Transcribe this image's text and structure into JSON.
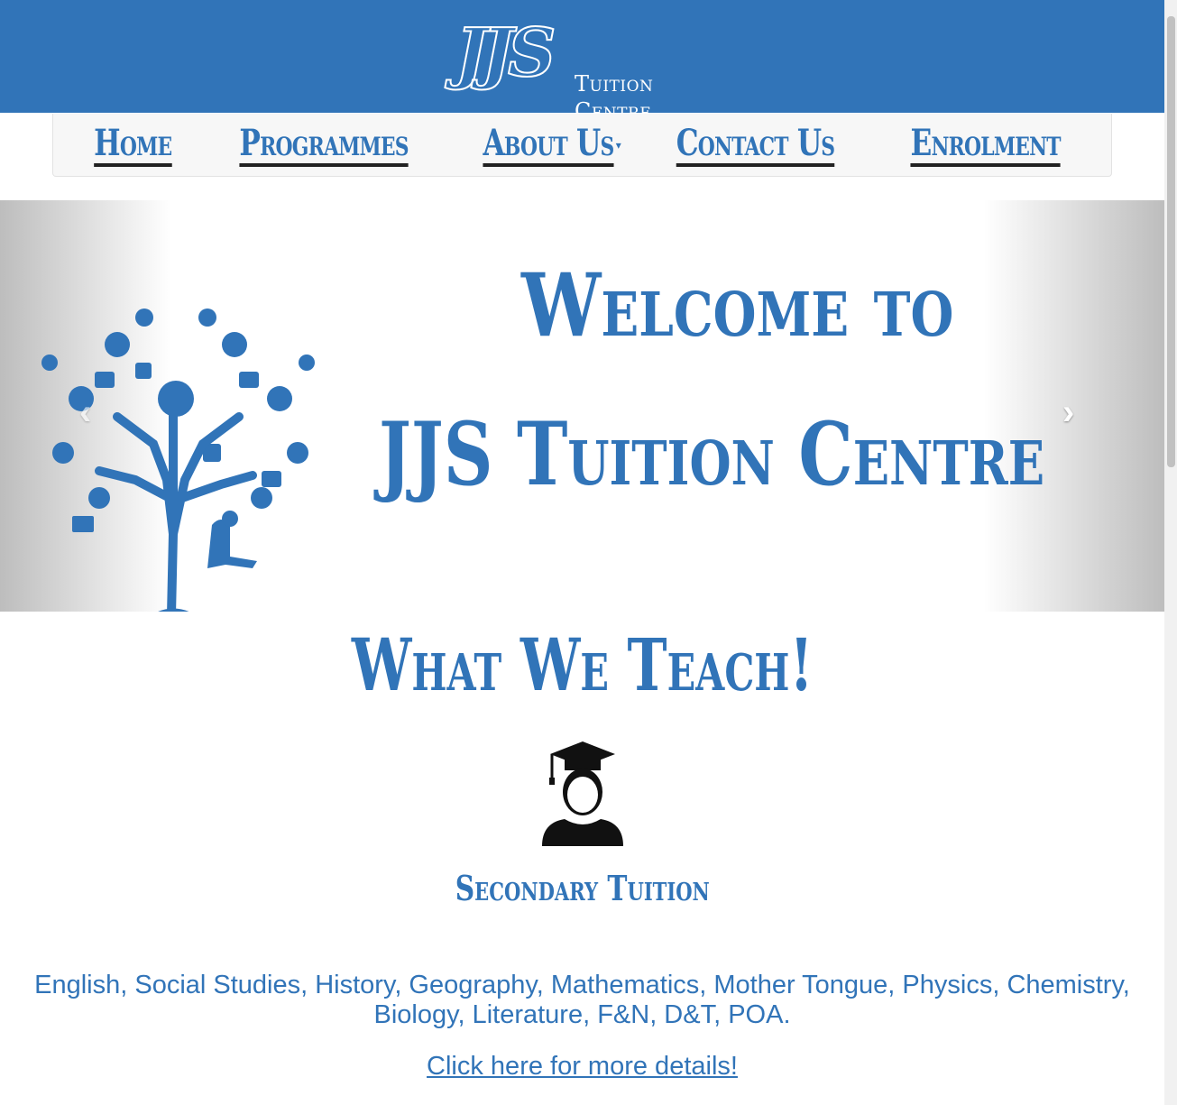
{
  "header": {
    "logo_mark": "JJS",
    "logo_sub": "Tuition Centre"
  },
  "nav": {
    "items": [
      {
        "label": "Home"
      },
      {
        "label": "Programmes"
      },
      {
        "label": "About Us",
        "has_dropdown": true
      },
      {
        "label": "Contact Us"
      },
      {
        "label": "Enrolment"
      }
    ]
  },
  "hero": {
    "line1": "Welcome to",
    "line2": "JJS Tuition Centre",
    "prev_icon": "chevron-left-icon",
    "next_icon": "chevron-right-icon"
  },
  "section": {
    "title": "What We Teach!",
    "card_title": "Secondary Tuition",
    "subjects_line1": "English, Social Studies, History, Geography, Mathematics, Mother Tongue, Physics, Chemistry,",
    "subjects_line2": "Biology, Literature, F&N, D&T, POA.",
    "details_link": "Click here for more details!"
  },
  "colors": {
    "brand_blue": "#3174b8",
    "nav_bg": "#f7f7f7"
  }
}
